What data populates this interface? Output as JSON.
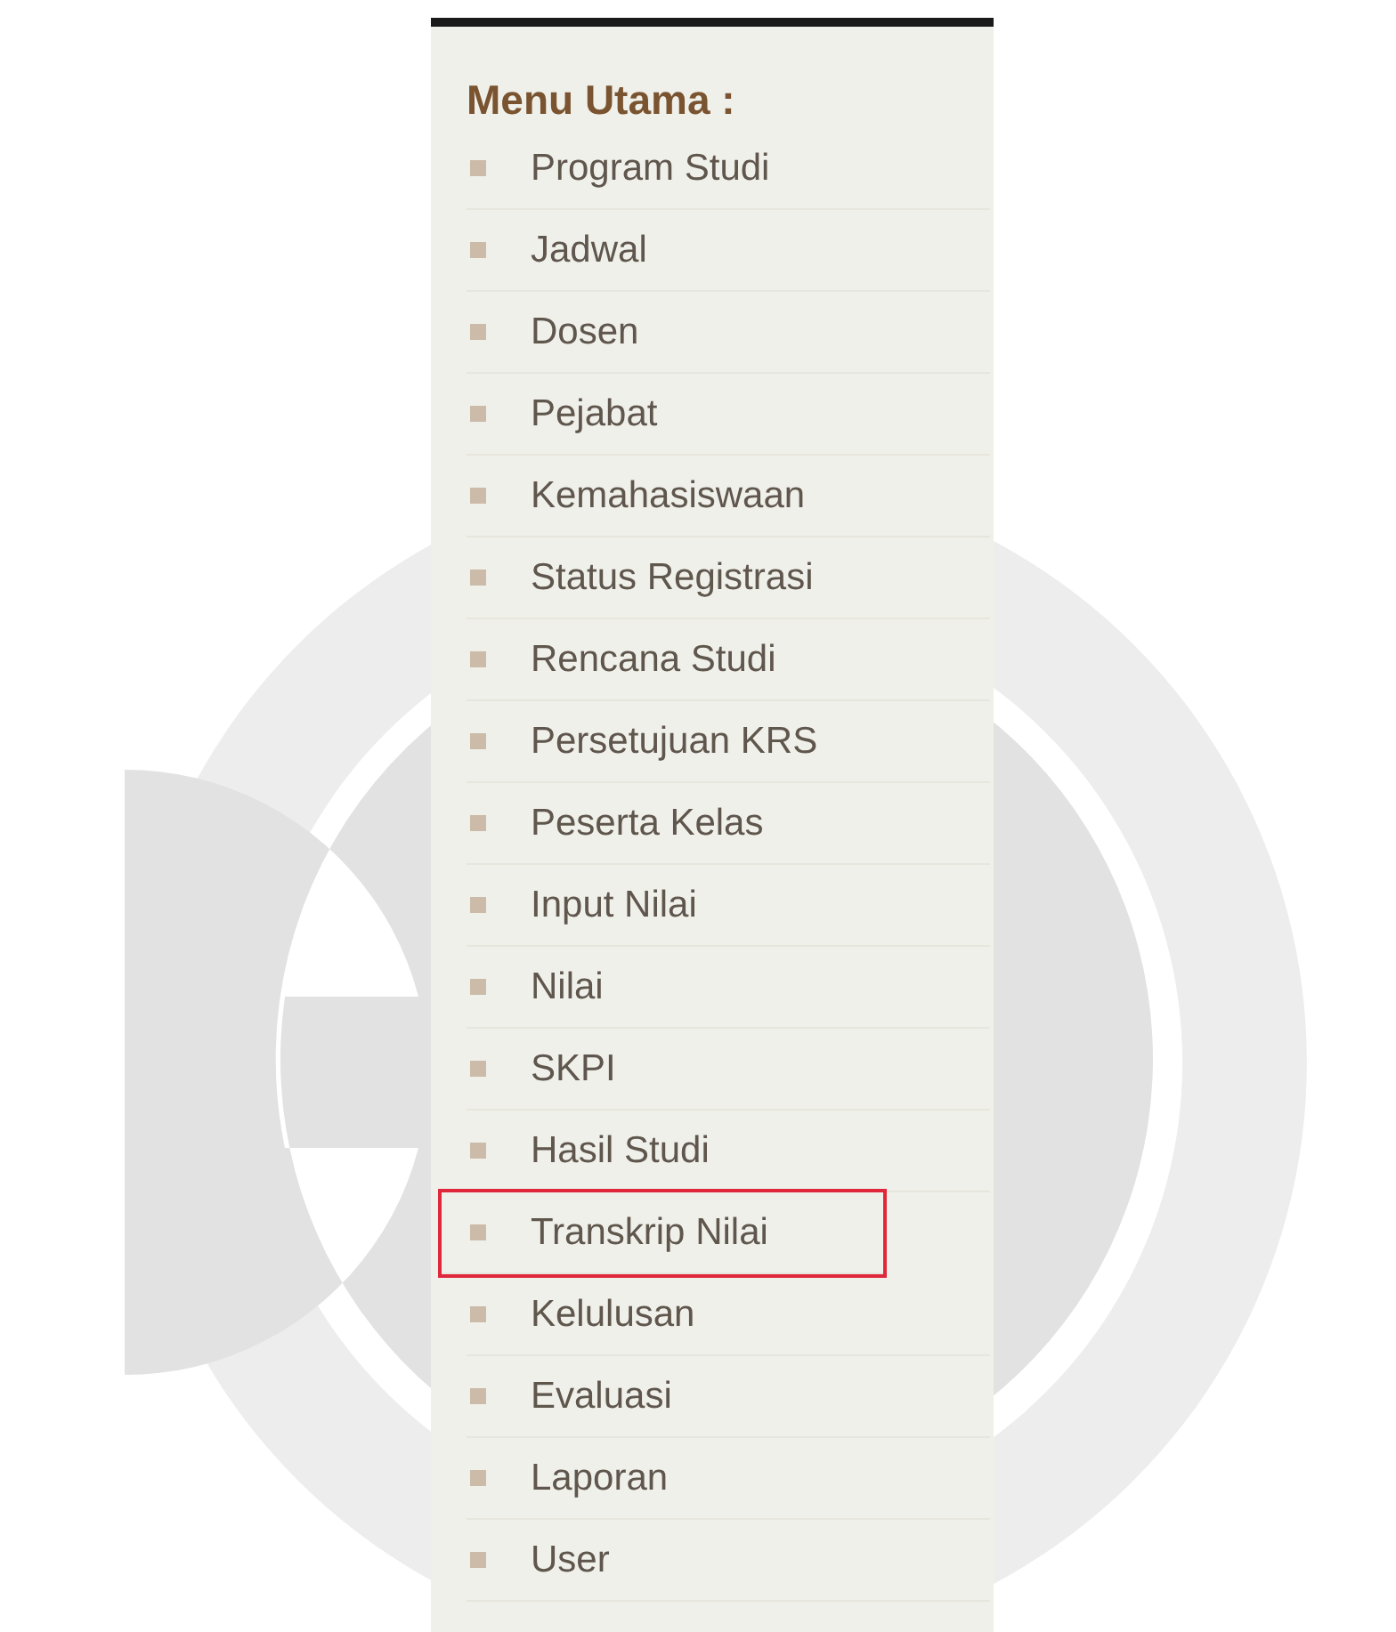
{
  "menu": {
    "title": "Menu Utama :",
    "items": [
      {
        "label": "Program Studi",
        "highlighted": false
      },
      {
        "label": "Jadwal",
        "highlighted": false
      },
      {
        "label": "Dosen",
        "highlighted": false
      },
      {
        "label": "Pejabat",
        "highlighted": false
      },
      {
        "label": "Kemahasiswaan",
        "highlighted": false
      },
      {
        "label": "Status Registrasi",
        "highlighted": false
      },
      {
        "label": "Rencana Studi",
        "highlighted": false
      },
      {
        "label": "Persetujuan KRS",
        "highlighted": false
      },
      {
        "label": "Peserta Kelas",
        "highlighted": false
      },
      {
        "label": "Input Nilai",
        "highlighted": false
      },
      {
        "label": "Nilai",
        "highlighted": false
      },
      {
        "label": "SKPI",
        "highlighted": false
      },
      {
        "label": "Hasil Studi",
        "highlighted": false
      },
      {
        "label": "Transkrip Nilai",
        "highlighted": true
      },
      {
        "label": "Kelulusan",
        "highlighted": false
      },
      {
        "label": "Evaluasi",
        "highlighted": false
      },
      {
        "label": "Laporan",
        "highlighted": false
      },
      {
        "label": "User",
        "highlighted": false
      }
    ]
  }
}
